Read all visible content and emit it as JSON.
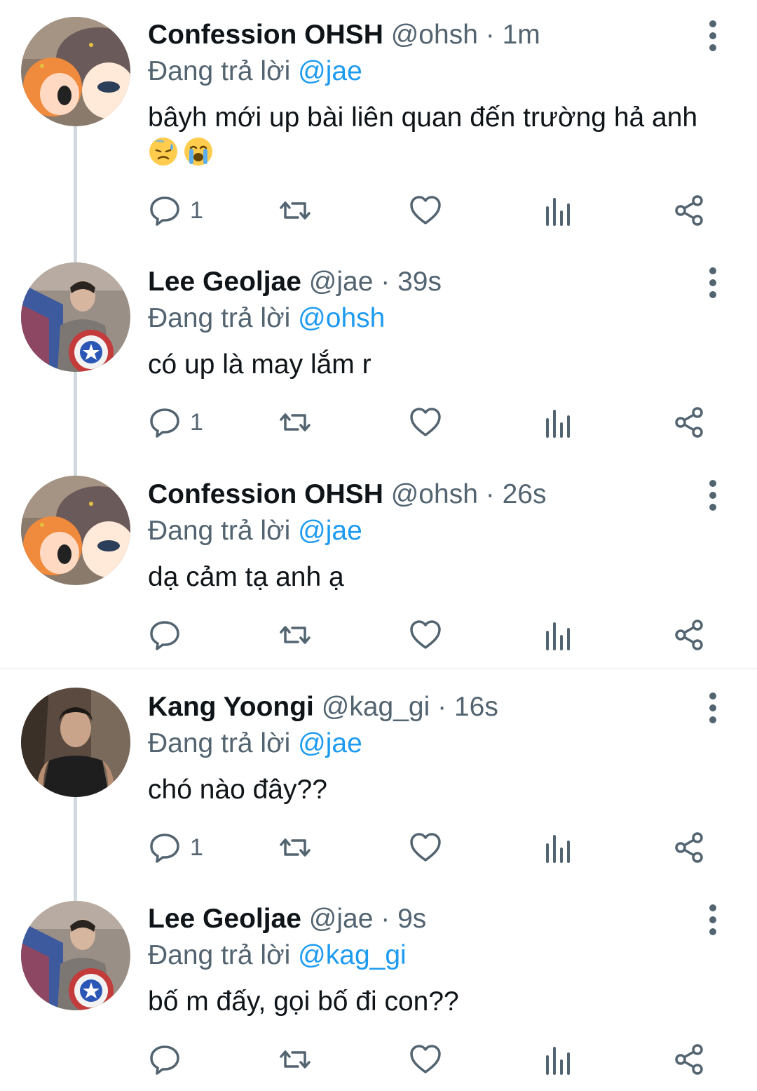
{
  "colors": {
    "text": "#0f1419",
    "secondary": "#536471",
    "link": "#1d9bf0",
    "line": "#cfd9de"
  },
  "reply_prefix": "Đang trả lời",
  "tweets": [
    {
      "name": "Confession OHSH",
      "handle": "@ohsh",
      "dot": "·",
      "time": "1m",
      "reply_to": "@jae",
      "text": "bâyh mới up bài liên quan đến trường hả anh",
      "emojis": [
        "downcast-sweat-emoji",
        "crying-emoji"
      ],
      "reply_count": "1",
      "avatar": "cartoon-avatar"
    },
    {
      "name": "Lee Geoljae",
      "handle": "@jae",
      "dot": "·",
      "time": "39s",
      "reply_to": "@ohsh",
      "text": "có up là may lắm r",
      "emojis": [],
      "reply_count": "1",
      "avatar": "person-shield-avatar"
    },
    {
      "name": "Confession OHSH",
      "handle": "@ohsh",
      "dot": "·",
      "time": "26s",
      "reply_to": "@jae",
      "text": "dạ cảm tạ anh ạ",
      "emojis": [],
      "reply_count": "",
      "avatar": "cartoon-avatar"
    },
    {
      "name": "Kang Yoongi",
      "handle": "@kag_gi",
      "dot": "·",
      "time": "16s",
      "reply_to": "@jae",
      "text": "chó nào đây??",
      "emojis": [],
      "reply_count": "1",
      "avatar": "person-dark-avatar"
    },
    {
      "name": "Lee Geoljae",
      "handle": "@jae",
      "dot": "·",
      "time": "9s",
      "reply_to": "@kag_gi",
      "text": "bố m đấy, gọi bố đi con??",
      "emojis": [],
      "reply_count": "",
      "avatar": "person-shield-avatar"
    }
  ]
}
